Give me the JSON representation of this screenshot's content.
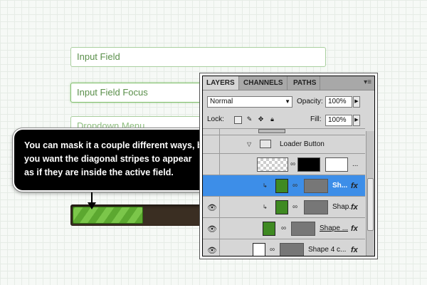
{
  "form": {
    "input_field": "Input Field",
    "input_field_focus": "Input Field Focus",
    "dropdown_menu": "Dropdown Menu"
  },
  "callout": {
    "line1": "You can mask it a couple different ways, but",
    "line2": "you want the diagonal stripes to appear",
    "line3": "as if they are inside the active field."
  },
  "loader": {
    "progress": 0.28,
    "stripe_color": "#5ca830",
    "track_color": "#3a2e22"
  },
  "panel": {
    "tabs": {
      "layers": "LAYERS",
      "channels": "CHANNELS",
      "paths": "PATHS"
    },
    "blend_mode": "Normal",
    "opacity_label": "Opacity:",
    "opacity_value": "100%",
    "lock_label": "Lock:",
    "fill_label": "Fill:",
    "fill_value": "100%",
    "group_name": "Loader Button",
    "layers": [
      {
        "name": "...",
        "selected": false
      },
      {
        "name": "Sh...",
        "selected": true
      },
      {
        "name": "Shap...",
        "selected": false
      },
      {
        "name": "Shape ...",
        "selected": false
      },
      {
        "name": "Shape 4 c...",
        "selected": false
      }
    ],
    "fx_label": "fx",
    "accent": "#3d8ee8"
  }
}
